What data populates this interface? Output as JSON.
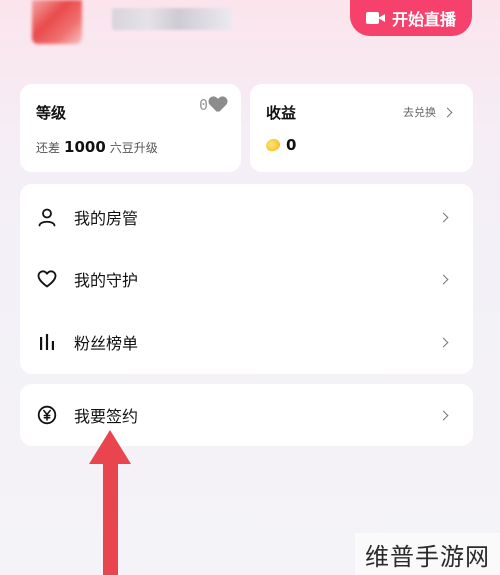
{
  "header": {
    "live_button_label": "开始直播"
  },
  "level_card": {
    "title": "等级",
    "badge_level": "0",
    "sub_prefix": "还差",
    "sub_amount": "1000",
    "sub_suffix": "六豆升级"
  },
  "income_card": {
    "title": "收益",
    "redeem_label": "去兑换",
    "coin_value": "0"
  },
  "menu": {
    "items": [
      {
        "label": "我的房管",
        "icon": "person-icon"
      },
      {
        "label": "我的守护",
        "icon": "heart-icon"
      },
      {
        "label": "粉丝榜单",
        "icon": "bar-chart-icon"
      }
    ]
  },
  "sign_item": {
    "label": "我要签约",
    "icon": "yen-circle-icon"
  },
  "annotation": {
    "arrow_color": "#e8454f"
  },
  "watermark": {
    "text": "维普手游网"
  },
  "colors": {
    "accent": "#f5416b"
  }
}
